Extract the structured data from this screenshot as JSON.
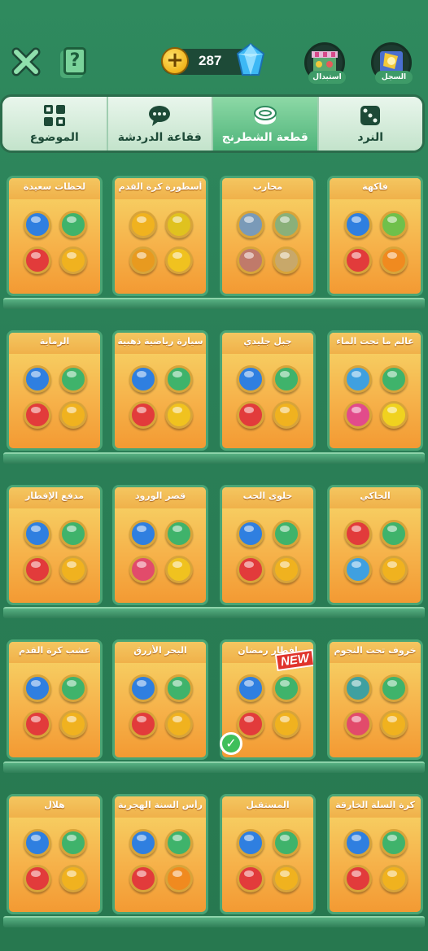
{
  "header": {
    "close_icon": "close-icon",
    "help_label": "?",
    "currency_plus": "+",
    "gem_count": "287",
    "exchange_label": "استبدال",
    "record_label": "السجل"
  },
  "tabs": [
    {
      "label": "الموضوع",
      "icon": "grid-icon",
      "active": false
    },
    {
      "label": "فقاعة الدردشة",
      "icon": "chat-icon",
      "active": false
    },
    {
      "label": "قطعة الشطرنج",
      "icon": "chess-piece-icon",
      "active": true
    },
    {
      "label": "النرد",
      "icon": "dice-icon",
      "active": false
    }
  ],
  "shelves": [
    {
      "cards": [
        {
          "title": "لحظات سعيدة",
          "colors": [
            "#2f7fe0",
            "#3fb36b",
            "#e23b3b",
            "#f0b21f"
          ]
        },
        {
          "title": "أسطورة كرة القدم",
          "colors": [
            "#f0b21f",
            "#f0b21f",
            "#f0b21f",
            "#f0b21f"
          ]
        },
        {
          "title": "محارب",
          "colors": [
            "#b0b0b0",
            "#b0b0b0",
            "#b0b0b0",
            "#b0b0b0"
          ]
        },
        {
          "title": "فاكهة",
          "colors": [
            "#2f7fe0",
            "#3fb36b",
            "#e23b3b",
            "#f08a1f"
          ]
        }
      ]
    },
    {
      "cards": [
        {
          "title": "الرماية",
          "colors": [
            "#2f7fe0",
            "#3fb36b",
            "#e23b3b",
            "#f0b21f"
          ]
        },
        {
          "title": "سيارة رياضية ذهبية",
          "colors": [
            "#2f7fe0",
            "#3fb36b",
            "#e23b3b",
            "#f0c21f"
          ]
        },
        {
          "title": "جبل جليدي",
          "colors": [
            "#2f7fe0",
            "#3fb36b",
            "#e23b3b",
            "#f0b21f"
          ]
        },
        {
          "title": "عالم ما تحت الماء",
          "colors": [
            "#3fa0e0",
            "#3fb36b",
            "#e24b8b",
            "#f0d21f"
          ]
        }
      ]
    },
    {
      "cards": [
        {
          "title": "مدفع الإفطار",
          "colors": [
            "#2f7fe0",
            "#3fb36b",
            "#e23b3b",
            "#f0b21f"
          ]
        },
        {
          "title": "قصر الورود",
          "colors": [
            "#2f7fe0",
            "#3fb36b",
            "#e24b6b",
            "#f0c21f"
          ]
        },
        {
          "title": "حلوى الحب",
          "colors": [
            "#2f7fe0",
            "#3fb36b",
            "#e23b3b",
            "#f0b21f"
          ]
        },
        {
          "title": "الحاكي",
          "colors": [
            "#e23b3b",
            "#3fb36b",
            "#3fa0e0",
            "#f0b21f"
          ]
        }
      ]
    },
    {
      "cards": [
        {
          "title": "عشب كرة القدم",
          "colors": [
            "#2f7fe0",
            "#3fb36b",
            "#e23b3b",
            "#f0b21f"
          ]
        },
        {
          "title": "البحر الأزرق",
          "colors": [
            "#2f7fe0",
            "#3fb36b",
            "#e23b3b",
            "#f0b21f"
          ]
        },
        {
          "title": "إفطار رمضان",
          "colors": [
            "#2f7fe0",
            "#3fb36b",
            "#e23b3b",
            "#f0b21f"
          ],
          "new_label": "NEW",
          "selected": true
        },
        {
          "title": "خروف تحت النجوم",
          "colors": [
            "#3fa0a0",
            "#3fb36b",
            "#e24b6b",
            "#f0b21f"
          ]
        }
      ]
    },
    {
      "cards": [
        {
          "title": "هلال",
          "colors": [
            "#2f7fe0",
            "#3fb36b",
            "#e23b3b",
            "#f0b21f"
          ]
        },
        {
          "title": "رأس السنة الهجرية",
          "colors": [
            "#2f7fe0",
            "#3fb36b",
            "#e23b3b",
            "#f08a1f"
          ]
        },
        {
          "title": "المستقبل",
          "colors": [
            "#2f7fe0",
            "#3fb36b",
            "#e23b3b",
            "#f0b21f"
          ]
        },
        {
          "title": "كرة السلة الخارقة",
          "colors": [
            "#2f7fe0",
            "#3fb36b",
            "#e23b3b",
            "#f0b21f"
          ]
        }
      ]
    }
  ]
}
